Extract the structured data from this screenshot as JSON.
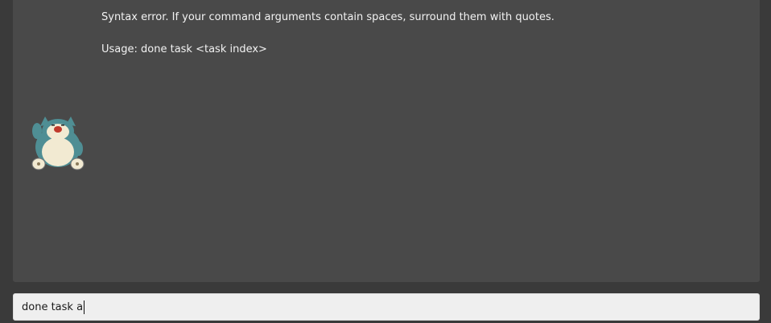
{
  "chat": {
    "messages": [
      {
        "lines": [
          "Syntax error. If your command arguments contain spaces, surround them with quotes.",
          "Usage: done task <task index>"
        ],
        "avatar": "snorlax-avatar-icon"
      }
    ]
  },
  "command_input": {
    "value": "done task a"
  }
}
